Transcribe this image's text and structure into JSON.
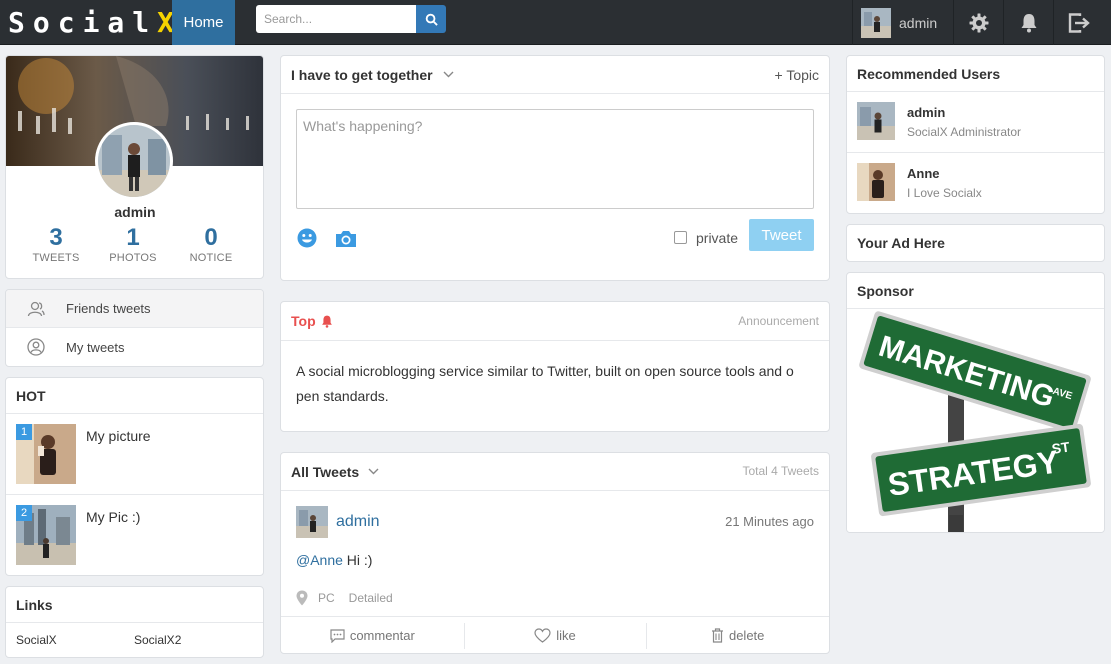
{
  "nav": {
    "logo_main": "Social",
    "logo_x": "X",
    "home_label": "Home",
    "search_placeholder": "Search...",
    "user_name": "admin",
    "icons": [
      "gear-icon",
      "bell-icon",
      "logout-icon"
    ]
  },
  "profile": {
    "name": "admin",
    "stats": [
      {
        "value": "3",
        "label": "TWEETS"
      },
      {
        "value": "1",
        "label": "PHOTOS"
      },
      {
        "value": "0",
        "label": "NOTICE"
      }
    ]
  },
  "menu": {
    "items": [
      {
        "label": "Friends tweets",
        "icon": "users-icon"
      },
      {
        "label": "My tweets",
        "icon": "user-icon"
      }
    ]
  },
  "hot": {
    "title": "HOT",
    "items": [
      {
        "rank": "1",
        "title": "My picture"
      },
      {
        "rank": "2",
        "title": "My Pic :)"
      }
    ]
  },
  "links": {
    "title": "Links",
    "items": [
      "SocialX",
      "SocialX2"
    ]
  },
  "composer": {
    "group_label": "I have to get together",
    "topic_label": "+ Topic",
    "placeholder": "What's happening?",
    "private_label": "private",
    "tweet_button": "Tweet"
  },
  "announcement": {
    "title": "Top",
    "tag": "Announcement",
    "text": "A social microblogging service similar to Twitter, built on open source tools and o pen standards."
  },
  "tweets": {
    "header": "All Tweets",
    "total": "Total 4 Tweets",
    "items": [
      {
        "author": "admin",
        "time": "21 Minutes ago",
        "mention": "@Anne",
        "text": " Hi :)",
        "source": "PC",
        "detail": "Detailed",
        "actions": {
          "comment": "commentar",
          "like": "like",
          "delete": "delete"
        }
      }
    ]
  },
  "recommended": {
    "title": "Recommended Users",
    "users": [
      {
        "name": "admin",
        "desc": "SocialX Administrator"
      },
      {
        "name": "Anne",
        "desc": "I Love Socialx"
      }
    ]
  },
  "ad": {
    "title": "Your Ad Here"
  },
  "sponsor": {
    "title": "Sponsor",
    "sign_top": "MARKETING",
    "sign_top_suffix": "AVE",
    "sign_bottom": "STRATEGY",
    "sign_bottom_suffix": "ST"
  },
  "colors": {
    "nav_bg": "#2b2f33",
    "accent": "#2f6f9f",
    "tweet_button": "#8fd0f2",
    "alert": "#e8504f"
  }
}
